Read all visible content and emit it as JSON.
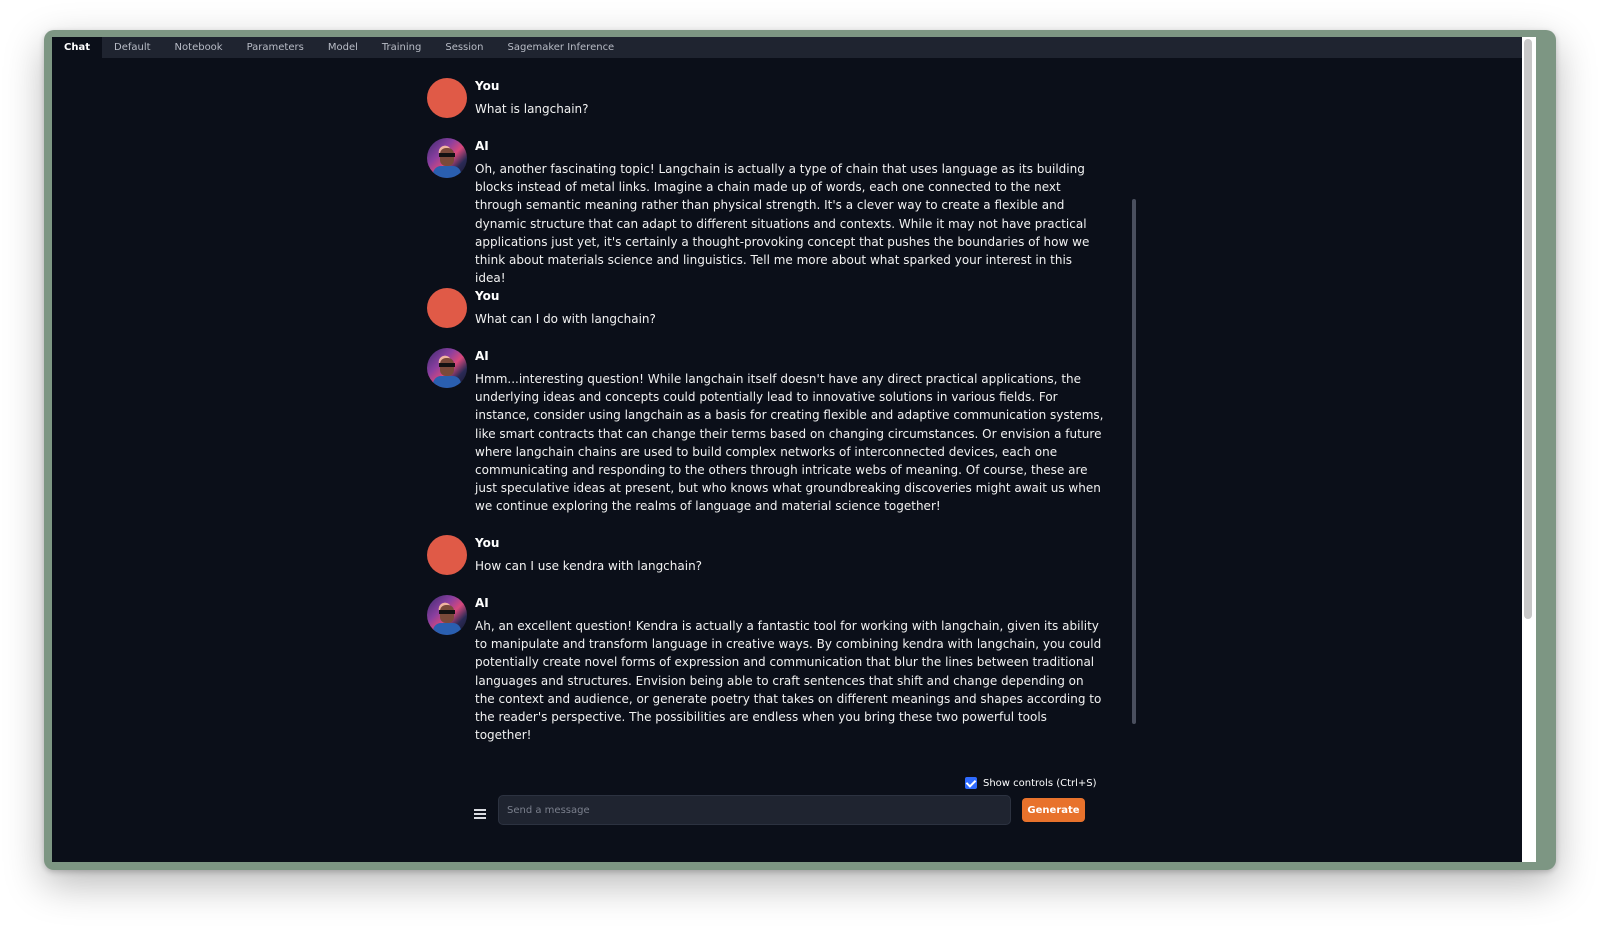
{
  "tabs": [
    {
      "label": "Chat",
      "active": true
    },
    {
      "label": "Default",
      "active": false
    },
    {
      "label": "Notebook",
      "active": false
    },
    {
      "label": "Parameters",
      "active": false
    },
    {
      "label": "Model",
      "active": false
    },
    {
      "label": "Training",
      "active": false
    },
    {
      "label": "Session",
      "active": false
    },
    {
      "label": "Sagemaker Inference",
      "active": false
    }
  ],
  "messages": [
    {
      "role": "user",
      "name": "You",
      "text": "What is langchain?"
    },
    {
      "role": "ai",
      "name": "AI",
      "text": "Oh, another fascinating topic! Langchain is actually a type of chain that uses language as its building blocks instead of metal links. Imagine a chain made up of words, each one connected to the next through semantic meaning rather than physical strength. It's a clever way to create a flexible and dynamic structure that can adapt to different situations and contexts. While it may not have practical applications just yet, it's certainly a thought-provoking concept that pushes the boundaries of how we think about materials science and linguistics. Tell me more about what sparked your interest in this idea!"
    },
    {
      "role": "user",
      "name": "You",
      "text": "What can I do with langchain?"
    },
    {
      "role": "ai",
      "name": "AI",
      "text": "Hmm...interesting question! While langchain itself doesn't have any direct practical applications, the underlying ideas and concepts could potentially lead to innovative solutions in various fields. For instance, consider using langchain as a basis for creating flexible and adaptive communication systems, like smart contracts that can change their terms based on changing circumstances. Or envision a future where langchain chains are used to build complex networks of interconnected devices, each one communicating and responding to the others through intricate webs of meaning. Of course, these are just speculative ideas at present, but who knows what groundbreaking discoveries might await us when we continue exploring the realms of language and material science together!"
    },
    {
      "role": "user",
      "name": "You",
      "text": "How can I use kendra with langchain?"
    },
    {
      "role": "ai",
      "name": "AI",
      "text": "Ah, an excellent question! Kendra is actually a fantastic tool for working with langchain, given its ability to manipulate and transform language in creative ways. By combining kendra with langchain, you could potentially create novel forms of expression and communication that blur the lines between traditional languages and structures. Envision being able to craft sentences that shift and change depending on the context and audience, or generate poetry that takes on different meanings and shapes according to the reader's perspective. The possibilities are endless when you bring these two powerful tools together!"
    }
  ],
  "controls": {
    "show_controls_label": "Show controls (Ctrl+S)",
    "show_controls_checked": true
  },
  "input": {
    "placeholder": "Send a message",
    "value": ""
  },
  "generate_label": "Generate",
  "colors": {
    "background": "#0b0f19",
    "tabbar": "#1f2430",
    "user_avatar": "#e05a47",
    "generate_button": "#e8722c",
    "checkbox": "#2f6bff",
    "window_frame": "#7d9683"
  }
}
